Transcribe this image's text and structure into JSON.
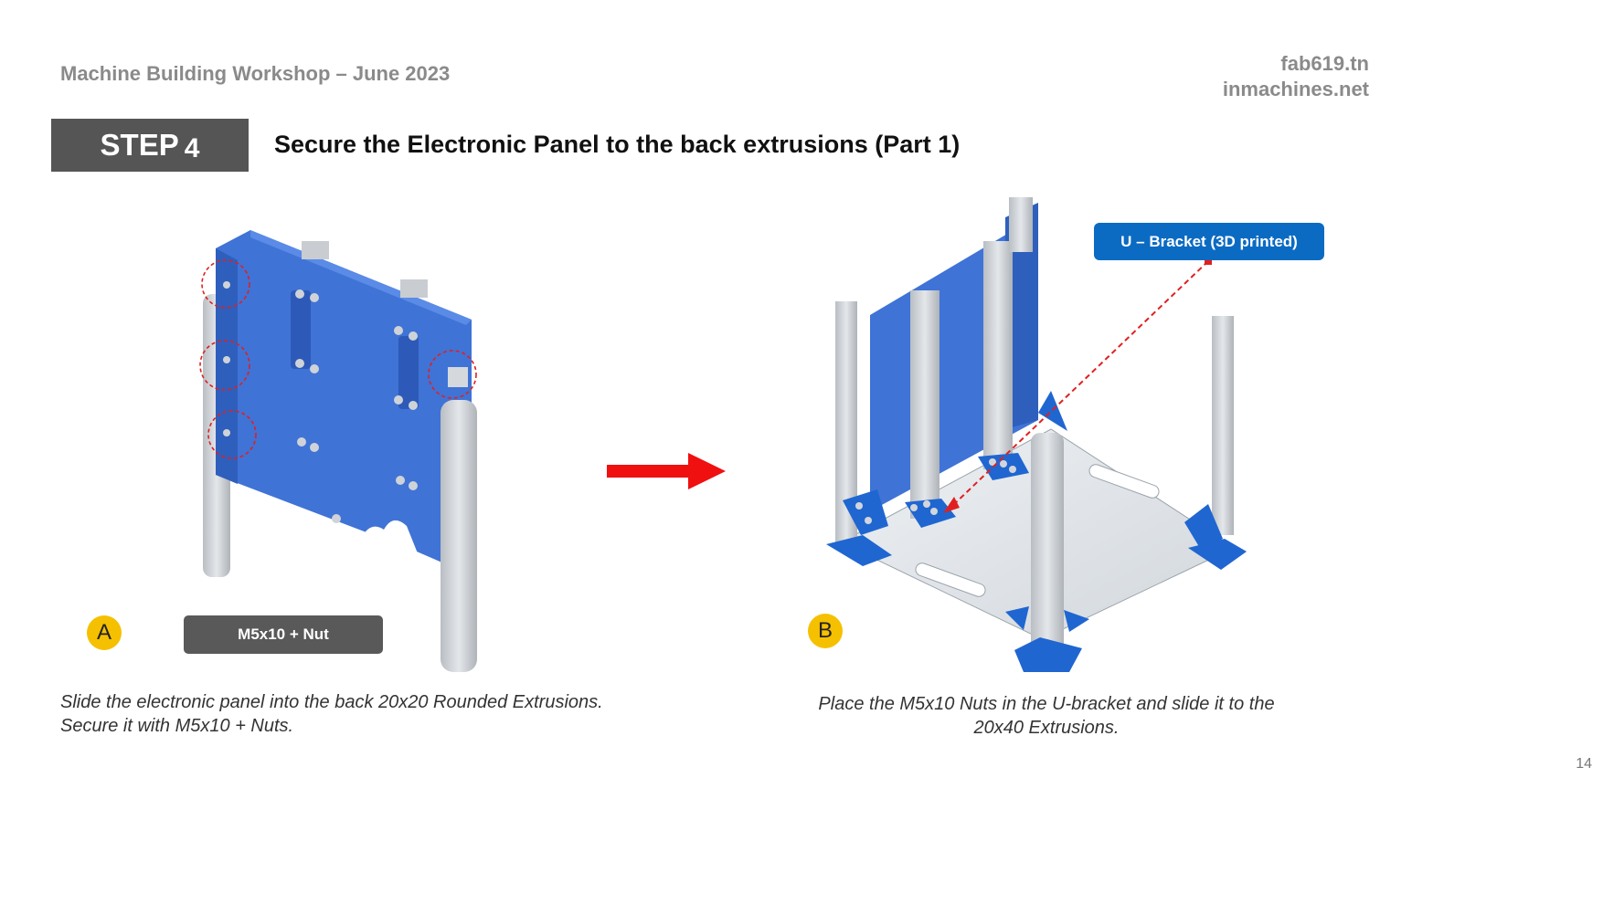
{
  "header": {
    "workshop": "Machine Building Workshop – June 2023",
    "site1": "fab619.tn",
    "site2": "inmachines.net"
  },
  "step": {
    "word": "STEP",
    "number": "4",
    "title": "Secure the Electronic Panel to the back extrusions (Part 1)"
  },
  "panel_a": {
    "badge": "A",
    "label": "M5x10 + Nut",
    "caption_line1": "Slide the electronic panel into the back 20x20 Rounded Extrusions.",
    "caption_line2": "Secure it with M5x10 + Nuts."
  },
  "panel_b": {
    "badge": "B",
    "callout": "U – Bracket (3D printed)",
    "caption_line1": "Place the M5x10 Nuts in the U-bracket and slide it to the",
    "caption_line2": "20x40 Extrusions."
  },
  "page_number": "14",
  "colors": {
    "panel_blue": "#3b6fd1",
    "callout_blue": "#0b6bc3",
    "badge_yellow": "#f5c000",
    "arrow_red": "#f01010",
    "step_gray": "#555555"
  }
}
